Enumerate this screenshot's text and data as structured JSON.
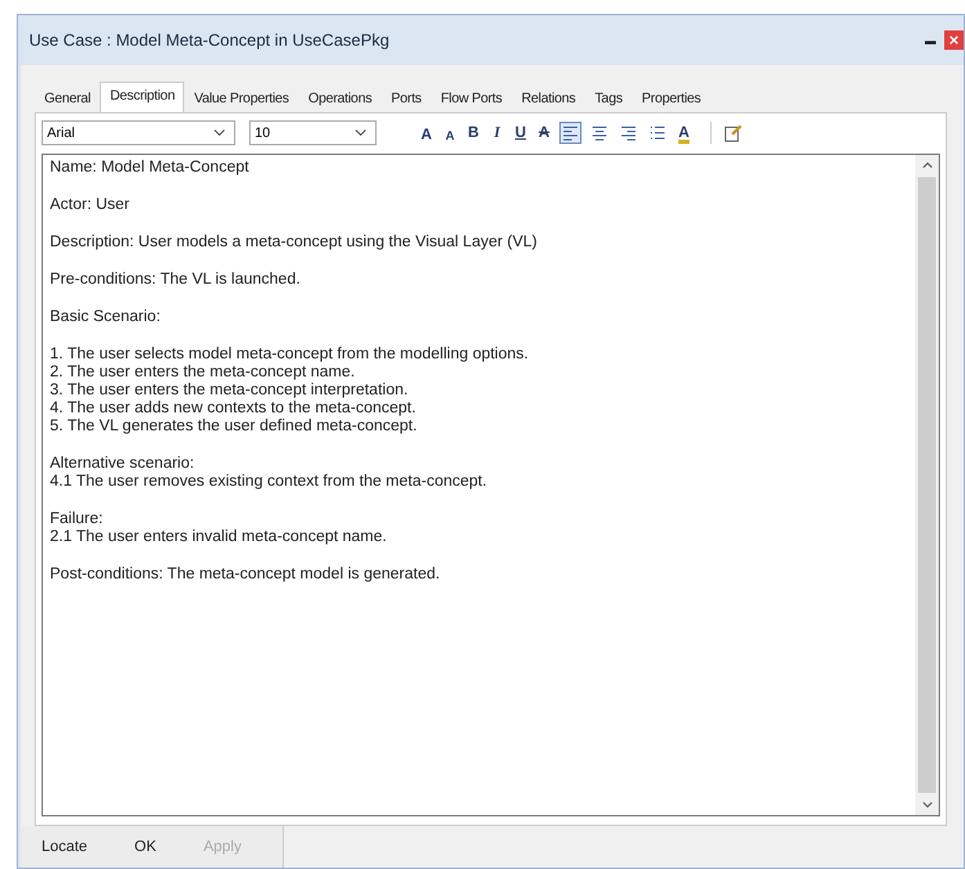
{
  "window": {
    "title": "Use Case : Model Meta-Concept in UseCasePkg",
    "minimize": "▬",
    "close": "×"
  },
  "tabs": [
    {
      "label": "General",
      "selected": false
    },
    {
      "label": "Description",
      "selected": true
    },
    {
      "label": "Value Properties",
      "selected": false
    },
    {
      "label": "Operations",
      "selected": false
    },
    {
      "label": "Ports",
      "selected": false
    },
    {
      "label": "Flow Ports",
      "selected": false
    },
    {
      "label": "Relations",
      "selected": false
    },
    {
      "label": "Tags",
      "selected": false
    },
    {
      "label": "Properties",
      "selected": false
    }
  ],
  "toolbar": {
    "font": "Arial",
    "size": "10",
    "format_buttons": [
      {
        "kind": "grow",
        "glyph": "A"
      },
      {
        "kind": "shrink",
        "glyph": "A"
      },
      {
        "kind": "bold",
        "glyph": "B"
      },
      {
        "kind": "italic",
        "glyph": "I"
      },
      {
        "kind": "underline",
        "glyph": "U"
      },
      {
        "kind": "strike",
        "glyph": "A"
      }
    ],
    "align_buttons": [
      {
        "kind": "left",
        "selected": true
      },
      {
        "kind": "center",
        "selected": false
      },
      {
        "kind": "right",
        "selected": false
      },
      {
        "kind": "list",
        "selected": false
      }
    ],
    "color_glyph": "A"
  },
  "description": [
    [
      "Name: Model Meta-Concept"
    ],
    [
      "Actor: User"
    ],
    [
      "Description: User models a meta-concept using the Visual Layer (VL)"
    ],
    [
      "Pre-conditions: The VL is launched."
    ],
    [
      "Basic Scenario:"
    ],
    [
      "1. The user selects model meta-concept from the modelling options.",
      "2. The user enters the meta-concept name.",
      "3. The user enters the meta-concept interpretation.",
      "4. The user adds new contexts to the meta-concept.",
      "5. The VL generates the user defined meta-concept."
    ],
    [
      "Alternative scenario:",
      "4.1 The user removes existing context from the meta-concept."
    ],
    [
      "Failure:",
      "2.1 The user enters invalid meta-concept name."
    ],
    [
      "Post-conditions: The meta-concept model is generated."
    ]
  ],
  "buttons": [
    {
      "label": "Locate",
      "disabled": false
    },
    {
      "label": "OK",
      "disabled": false
    },
    {
      "label": "Apply",
      "disabled": true
    }
  ]
}
